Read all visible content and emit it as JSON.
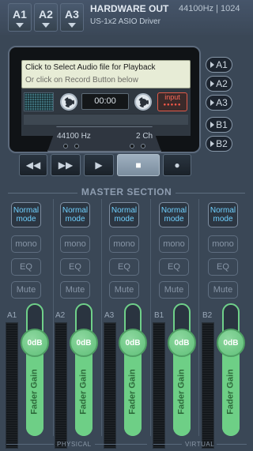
{
  "header": {
    "bus_buttons": [
      "A1",
      "A2",
      "A3"
    ],
    "title": "HARDWARE OUT",
    "rate": "44100Hz | 1024",
    "driver": "US-1x2 ASIO Driver"
  },
  "player": {
    "message_line1": "Click to Select Audio file for Playback",
    "message_line2": "Or click on Record Button below",
    "time": "00:00",
    "input_label": "input",
    "input_dots": "●●●●●",
    "sample_rate": "44100 Hz",
    "channels": "2 Ch",
    "side_buttons": [
      "A1",
      "A2",
      "A3",
      "B1",
      "B2"
    ]
  },
  "transport": {
    "rewind": "◀◀",
    "forward": "▶▶",
    "play": "▶",
    "stop": "■",
    "record": "●"
  },
  "master": {
    "title": "MASTER SECTION",
    "physical_label": "PHYSICAL",
    "virtual_label": "VIRTUAL",
    "strips": [
      {
        "label": "A1",
        "mode_line1": "Normal",
        "mode_line2": "mode",
        "mono": "mono",
        "eq": "EQ",
        "mute": "Mute",
        "gain": "0dB",
        "fader_label": "Fader Gain"
      },
      {
        "label": "A2",
        "mode_line1": "Normal",
        "mode_line2": "mode",
        "mono": "mono",
        "eq": "EQ",
        "mute": "Mute",
        "gain": "0dB",
        "fader_label": "Fader Gain"
      },
      {
        "label": "A3",
        "mode_line1": "Normal",
        "mode_line2": "mode",
        "mono": "mono",
        "eq": "EQ",
        "mute": "Mute",
        "gain": "0dB",
        "fader_label": "Fader Gain"
      },
      {
        "label": "B1",
        "mode_line1": "Normal",
        "mode_line2": "mode",
        "mono": "mono",
        "eq": "EQ",
        "mute": "Mute",
        "gain": "0dB",
        "fader_label": "Fader Gain"
      },
      {
        "label": "B2",
        "mode_line1": "Normal",
        "mode_line2": "mode",
        "mono": "mono",
        "eq": "EQ",
        "mute": "Mute",
        "gain": "0dB",
        "fader_label": "Fader Gain"
      }
    ]
  }
}
